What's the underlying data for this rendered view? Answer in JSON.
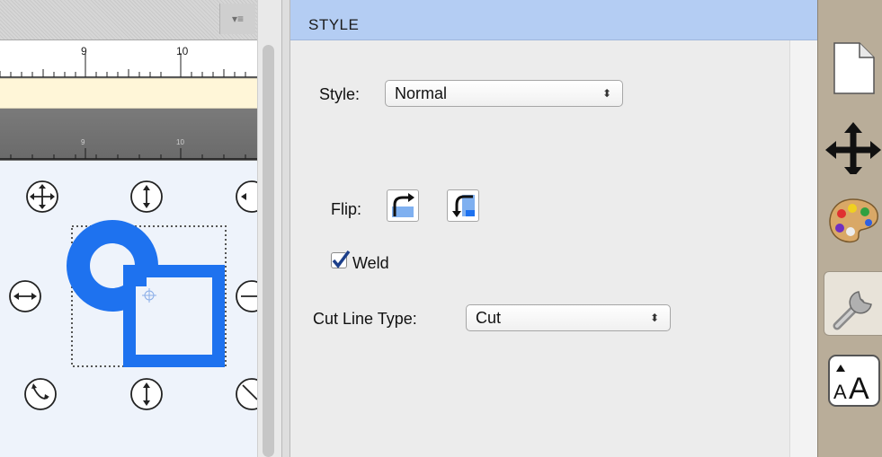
{
  "panel": {
    "title": "STYLE",
    "menu_icon": "list-menu-icon"
  },
  "ruler": {
    "top_labels": [
      "9",
      "10"
    ],
    "dark_labels": [
      "9",
      "10"
    ]
  },
  "style_field": {
    "label": "Style:",
    "value": "Normal"
  },
  "flip": {
    "label": "Flip:",
    "buttons": [
      "flip-horizontal-icon",
      "flip-vertical-icon"
    ]
  },
  "weld": {
    "label": "Weld",
    "checked": true
  },
  "cut_line": {
    "label": "Cut Line Type:",
    "value": "Cut"
  },
  "toolbar": {
    "items": [
      "page-icon",
      "move-icon",
      "palette-icon",
      "wrench-icon",
      "text-size-icon"
    ],
    "text_icon_glyph": "AA"
  },
  "colors": {
    "accent_blue": "#1e72ef",
    "header_blue": "#b4cdf3",
    "toolbar_bg": "#b9ad99"
  }
}
